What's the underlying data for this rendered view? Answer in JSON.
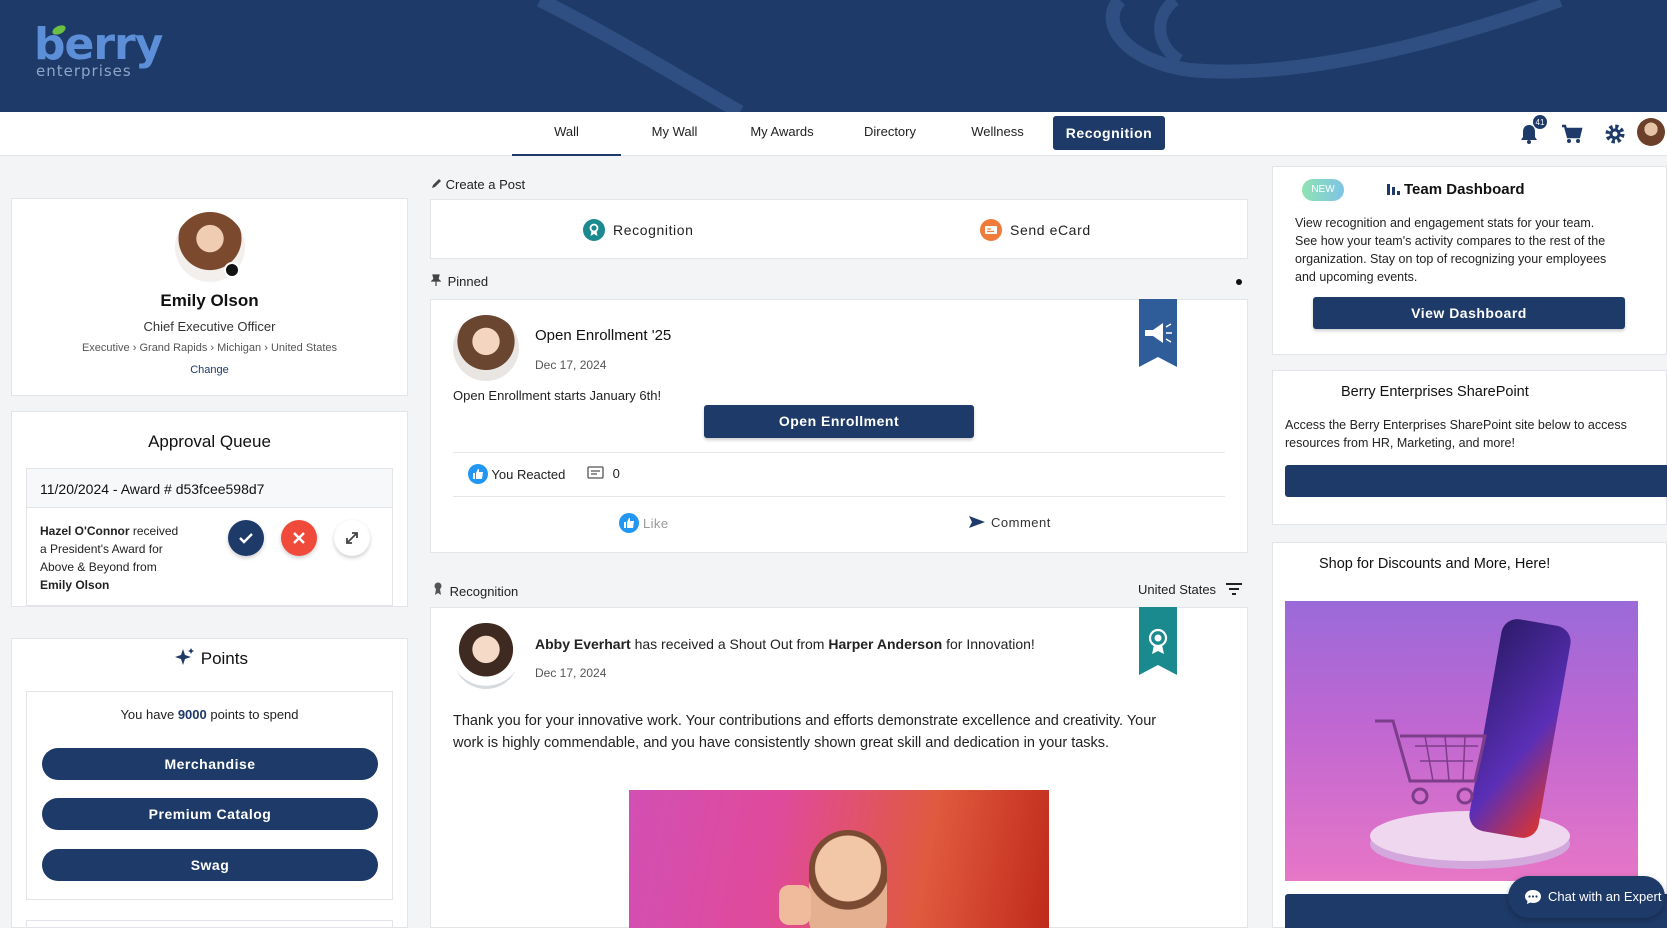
{
  "brand": {
    "word": "berry",
    "sub": "enterprises"
  },
  "nav": {
    "tabs": [
      "Wall",
      "My Wall",
      "My Awards",
      "Directory",
      "Wellness",
      "Recognition"
    ],
    "notification_count": "41"
  },
  "profile": {
    "name": "Emily Olson",
    "title": "Chief Executive Officer",
    "path": [
      "Executive",
      "Grand Rapids",
      "Michigan",
      "United States"
    ],
    "path_sep": "›",
    "change": "Change"
  },
  "approval": {
    "heading": "Approval Queue",
    "item_header": "11/20/2024 - Award # d53fcee598d7",
    "from_person": "Hazel O'Connor",
    "t1": " received",
    "t2": "a President's Award for",
    "t3": "Above & Beyond from",
    "to_person": "Emily Olson"
  },
  "points": {
    "heading": "Points",
    "text_before": "You have ",
    "amount": "9000",
    "text_after": " points to spend",
    "buttons": [
      "Merchandise",
      "Premium Catalog",
      "Swag"
    ]
  },
  "create_post": {
    "label": "Create a Post",
    "recognition": "Recognition",
    "ecard": "Send eCard"
  },
  "pinned": {
    "label": "Pinned",
    "title": "Open Enrollment '25",
    "date": "Dec 17, 2024",
    "body": "Open Enrollment starts January 6th!",
    "button": "Open Enrollment",
    "reacted": "You Reacted",
    "comments": "0",
    "like": "Like",
    "comment": "Comment"
  },
  "recognition_feed": {
    "label": "Recognition",
    "filter": "United States",
    "recipient": "Abby Everhart",
    "m1": " has received a Shout Out from ",
    "sender": "Harper Anderson",
    "m2": " for Innovation!",
    "date": "Dec 17, 2024",
    "body1": "Thank you for your innovative work. Your contributions and efforts demonstrate excellence and creativity. Your",
    "body2": "work is highly commendable, and you have consistently shown great skill and dedication in your tasks."
  },
  "team_dashboard": {
    "badge": "NEW",
    "title": "Team Dashboard",
    "lines": [
      "View recognition and engagement stats for your team.",
      "See how your team's activity compares to the rest of the",
      "organization. Stay on top of recognizing your employees",
      "and upcoming events."
    ],
    "button": "View Dashboard"
  },
  "sharepoint": {
    "title": "Berry Enterprises SharePoint",
    "lines": [
      "Access the Berry Enterprises SharePoint site below to access",
      "resources from HR, Marketing, and more!"
    ]
  },
  "shop": {
    "title": "Shop for Discounts and More, Here!"
  },
  "chat": {
    "label": "Chat with an Expert"
  },
  "colors": {
    "navy": "#1e3a68",
    "teal": "#1a8a8f",
    "orange": "#f07a3a",
    "red": "#f04a3a",
    "accent_blue": "#2196f3"
  }
}
